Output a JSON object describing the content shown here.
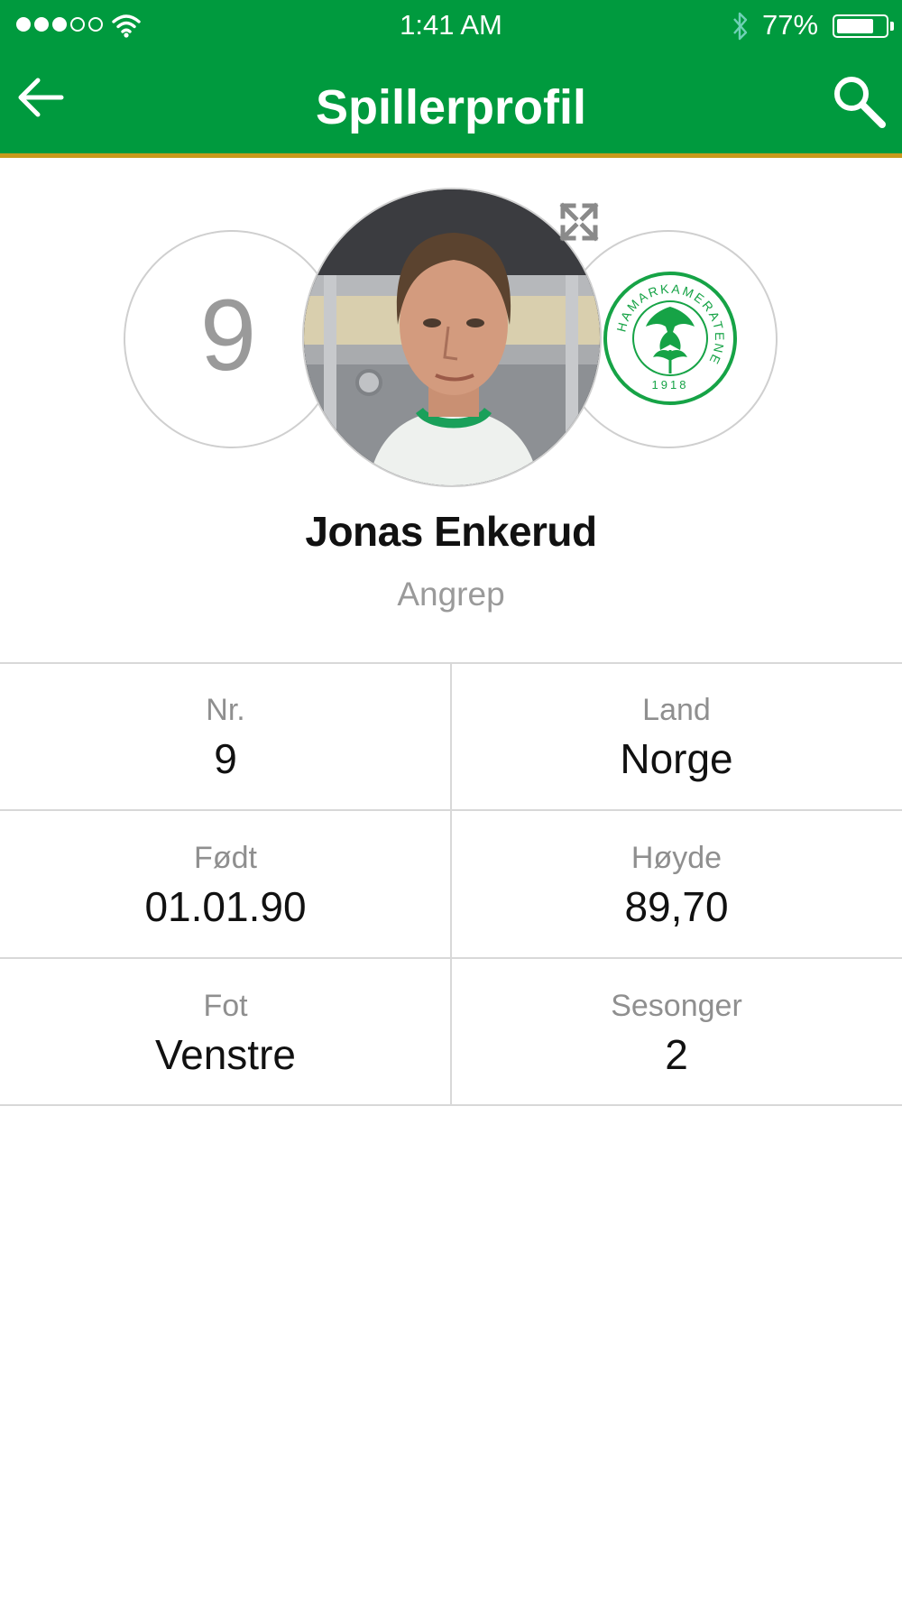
{
  "status_bar": {
    "time": "1:41 AM",
    "battery_percent_text": "77%",
    "battery_level": 0.77,
    "signal_bars_filled": 3,
    "signal_bars_total": 5,
    "icons": [
      "signal-dots",
      "wifi-icon",
      "bluetooth-icon",
      "battery-icon"
    ]
  },
  "header": {
    "title": "Spillerprofil",
    "back_icon": "back-arrow-icon",
    "search_icon": "search-icon"
  },
  "colors": {
    "brand_green": "#009a3e",
    "header_accent": "#c89a1c",
    "muted_text": "#9a9a9a",
    "divider": "#d8d8d8"
  },
  "profile": {
    "shirt_number": "9",
    "name": "Jonas Enkerud",
    "position": "Angrep",
    "expand_icon": "expand-icon",
    "club_logo": {
      "ring_text": "HAMARKAMERATENE",
      "year": "1918"
    }
  },
  "stats": [
    {
      "label": "Nr.",
      "value": "9"
    },
    {
      "label": "Land",
      "value": "Norge"
    },
    {
      "label": "Født",
      "value": "01.01.90"
    },
    {
      "label": "Høyde",
      "value": "89,70"
    },
    {
      "label": "Fot",
      "value": "Venstre"
    },
    {
      "label": "Sesonger",
      "value": "2"
    }
  ]
}
